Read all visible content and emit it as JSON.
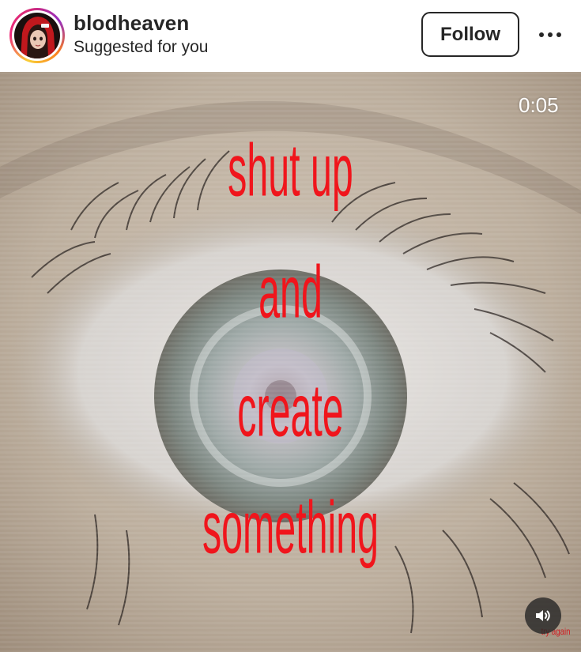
{
  "post_header": {
    "username": "blodheaven",
    "subtitle": "Suggested for you",
    "follow_label": "Follow",
    "more_icon": "more-horizontal-icon"
  },
  "media": {
    "timer": "0:05",
    "caption_lines": [
      "shut up",
      "and",
      "create",
      "something"
    ],
    "caption_color": "#f0151c",
    "watermark": "try again",
    "audio_icon": "speaker-icon"
  },
  "colors": {
    "text": "#262626",
    "ring": [
      "#f9ce34",
      "#ee2a7b",
      "#962fbf"
    ]
  }
}
